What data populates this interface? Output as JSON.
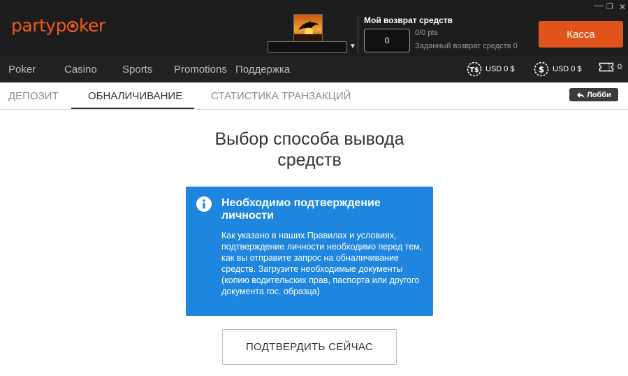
{
  "brand": {
    "part1": "party",
    "part2_prefix": "p",
    "part2_suffix": "ker",
    "color": "#f05a1e"
  },
  "window_controls": {
    "minimize": "—",
    "restore": "❐",
    "close": "✕"
  },
  "avatar": {
    "icon": "dolphin-sunset-image"
  },
  "cashback": {
    "title": "Мой возврат средств",
    "value": "0",
    "points": "0/0 pts",
    "target": "Заданный возврат средств 0"
  },
  "header": {
    "cashier_label": "Касса",
    "accent": "#e0531a"
  },
  "nav": {
    "items": [
      "Poker",
      "Casino",
      "Sports",
      "Promotions",
      "Поддержка"
    ]
  },
  "balances": [
    {
      "icon": "tournament-dollar-icon",
      "label": "USD 0 $"
    },
    {
      "icon": "dollar-coin-icon",
      "label": "USD 0 $"
    },
    {
      "icon": "ticket-icon",
      "label": "0"
    }
  ],
  "tabs": {
    "items": [
      "ДЕПОЗИТ",
      "ОБНАЛИЧИВАНИЕ",
      "СТАТИСТИКА ТРАНЗАКЦИЙ"
    ],
    "active": "ОБНАЛИЧИВАНИЕ",
    "lobby_label": "Лобби"
  },
  "main": {
    "title_line1": "Выбор способа вывода",
    "title_line2": "средств",
    "info": {
      "heading": "Необходимо подтверждение личности",
      "text": "Как указано в наших Правилах и условиях, подтверждение личности необходимо перед тем, как вы отправите запрос на обналичивание средств. Загрузите необходимые документы (копию водительских прав, паспорта или другого документа гос. образца)",
      "color": "#1f86e0"
    },
    "confirm_label": "ПОДТВЕРДИТЬ СЕЙЧАС"
  }
}
